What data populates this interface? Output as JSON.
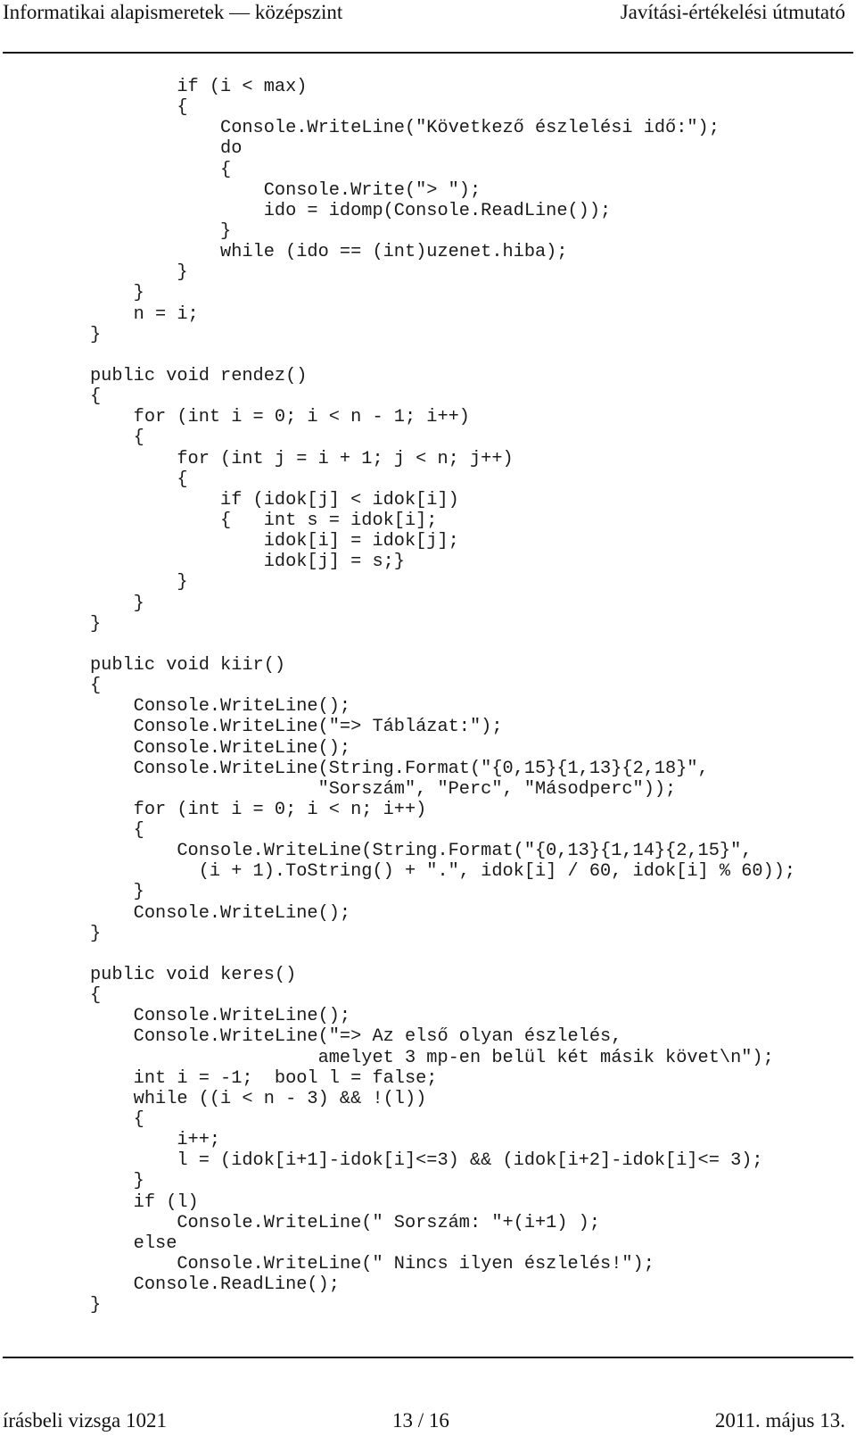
{
  "header": {
    "left": "Informatikai alapismeretek — középszint",
    "right": "Javítási-értékelési útmutató"
  },
  "code": {
    "lines": [
      "        if (i < max)",
      "        {",
      "            Console.WriteLine(\"Következő észlelési idő:\");",
      "            do",
      "            {",
      "                Console.Write(\"> \");",
      "                ido = idomp(Console.ReadLine());",
      "            }",
      "            while (ido == (int)uzenet.hiba);",
      "        }",
      "    }",
      "    n = i;",
      "}",
      "",
      "public void rendez()",
      "{",
      "    for (int i = 0; i < n - 1; i++)",
      "    {",
      "        for (int j = i + 1; j < n; j++)",
      "        {",
      "            if (idok[j] < idok[i])",
      "            {   int s = idok[i];",
      "                idok[i] = idok[j];",
      "                idok[j] = s;}",
      "        }",
      "    }",
      "}",
      "",
      "public void kiir()",
      "{",
      "    Console.WriteLine();",
      "    Console.WriteLine(\"=> Táblázat:\");",
      "    Console.WriteLine();",
      "    Console.WriteLine(String.Format(\"{0,15}{1,13}{2,18}\",",
      "                     \"Sorszám\", \"Perc\", \"Másodperc\"));",
      "    for (int i = 0; i < n; i++)",
      "    {",
      "        Console.WriteLine(String.Format(\"{0,13}{1,14}{2,15}\",",
      "          (i + 1).ToString() + \".\", idok[i] / 60, idok[i] % 60));",
      "    }",
      "    Console.WriteLine();",
      "}",
      "",
      "public void keres()",
      "{",
      "    Console.WriteLine();",
      "    Console.WriteLine(\"=> Az első olyan észlelés,",
      "                     amelyet 3 mp-en belül két másik követ\\n\");",
      "    int i = -1;  bool l = false;",
      "    while ((i < n - 3) && !(l))",
      "    {",
      "        i++;",
      "        l = (idok[i+1]-idok[i]<=3) && (idok[i+2]-idok[i]<= 3);",
      "    }",
      "    if (l)",
      "        Console.WriteLine(\" Sorszám: \"+(i+1) );",
      "    else",
      "        Console.WriteLine(\" Nincs ilyen észlelés!\");",
      "    Console.ReadLine();",
      "}"
    ]
  },
  "footer": {
    "left": "írásbeli vizsga 1021",
    "center": "13 / 16",
    "right": "2011. május 13."
  }
}
